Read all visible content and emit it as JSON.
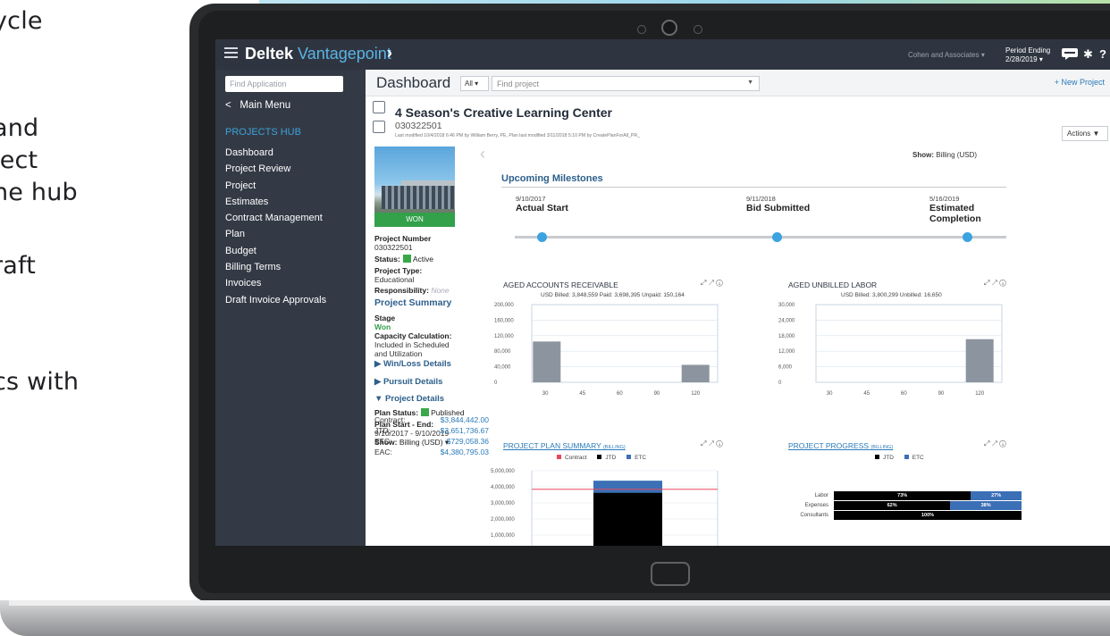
{
  "side_text": [
    "ycle",
    "and",
    "ject",
    "he hub",
    "raft",
    "cs with"
  ],
  "topbar": {
    "brand_main": "Deltek",
    "brand_sub": "Vantagepoint",
    "company": "Cohen and Associates ▾",
    "period_label": "Period Ending",
    "period_value": "2/28/2019 ▾"
  },
  "sidebar": {
    "search_placeholder": "Find Application",
    "main_menu": "Main Menu",
    "hub_title": "PROJECTS HUB",
    "items": [
      "Dashboard",
      "Project Review",
      "Project",
      "Estimates",
      "Contract Management",
      "Plan",
      "Budget",
      "Billing Terms",
      "Invoices",
      "Draft Invoice Approvals"
    ]
  },
  "dashbar": {
    "title": "Dashboard",
    "filter": "All ▾",
    "search_placeholder": "Find project",
    "new_project": "+ New Project"
  },
  "project": {
    "name": "4 Season's Creative Learning Center",
    "number": "030322501",
    "modified": "Last modified 10/4/2018 6:46 PM by William Berry, PE, Plan last modified 3/11/2018 5:10 PM by CreatePlanForAll_PR_",
    "actions": "Actions ▼",
    "status_badge": "WON"
  },
  "info": {
    "project_number_label": "Project Number",
    "project_number_value": "030322501",
    "status_label": "Status:",
    "status_value": "Active",
    "type_label": "Project Type:",
    "type_value": "Educational",
    "resp_label": "Responsibility:",
    "resp_value": "None",
    "summary_title": "Project Summary",
    "stage_label": "Stage",
    "stage_value": "Won",
    "capacity_label": "Capacity Calculation:",
    "capacity_value_1": "Included in Scheduled",
    "capacity_value_2": "and Utilization",
    "winloss": "▶  Win/Loss Details",
    "pursuit": "▶  Pursuit Details",
    "projdetails": "▼  Project Details",
    "plan_status_label": "Plan Status:",
    "plan_status_value": "Published",
    "plan_start_label": "Plan Start - End:",
    "plan_start_value": "9/10/2017 - 9/10/2019",
    "show_label": "Show:",
    "show_value": "Billing (USD) ▾",
    "fin": [
      {
        "label": "Contract:",
        "value": "$3,844,442.00"
      },
      {
        "label": "JTD:",
        "value": "$3,651,736.67"
      },
      {
        "label": "ETC:",
        "value": "$729,058.36"
      },
      {
        "label": "EAC:",
        "value": "$4,380,795.03"
      }
    ]
  },
  "content": {
    "show_label": "Show:",
    "show_value": "Billing (USD)",
    "milestones_title": "Upcoming Milestones",
    "milestones": [
      {
        "date": "9/10/2017",
        "name": "Actual Start",
        "name2": ""
      },
      {
        "date": "9/11/2018",
        "name": "Bid Submitted",
        "name2": ""
      },
      {
        "date": "5/16/2019",
        "name": "Estimated",
        "name2": "Completion"
      }
    ],
    "panel_icons": "⤢  ↗  ⓘ",
    "ar_title": "AGED ACCOUNTS RECEIVABLE",
    "ar_sub": "USD   Billed: 3,848,559  Paid: 3,698,395  Unpaid: 150,164",
    "ul_title": "AGED UNBILLED LABOR",
    "ul_sub": "USD   Billed: 3,800,299   Unbilled: 16,650",
    "plan_title": "PROJECT PLAN SUMMARY",
    "plan_title_small": "(BILLING)",
    "progress_title": "PROJECT PROGRESS",
    "progress_title_small": "(BILLING)",
    "plan_legend": [
      "Contract",
      "JTD",
      "ETC"
    ],
    "progress_legend": [
      "JTD",
      "ETC"
    ]
  },
  "chart_data": [
    {
      "type": "bar",
      "title": "AGED ACCOUNTS RECEIVABLE",
      "categories": [
        "30",
        "45",
        "60",
        "90",
        "120"
      ],
      "values": [
        105000,
        0,
        0,
        0,
        45000
      ],
      "ylim": [
        0,
        200000
      ],
      "yticks": [
        "200,000",
        "160,000",
        "120,000",
        "80,000",
        "40,000",
        "0"
      ],
      "color": "#8c959f"
    },
    {
      "type": "bar",
      "title": "AGED UNBILLED LABOR",
      "categories": [
        "30",
        "45",
        "60",
        "90",
        "120"
      ],
      "values": [
        0,
        0,
        0,
        0,
        16650
      ],
      "ylim": [
        0,
        30000
      ],
      "yticks": [
        "30,000",
        "24,000",
        "18,000",
        "12,000",
        "6,000",
        "0"
      ],
      "color": "#8c959f"
    },
    {
      "type": "bar",
      "title": "PROJECT PLAN SUMMARY (BILLING)",
      "series": [
        {
          "name": "Contract",
          "values": [
            3844442
          ],
          "color": "#e8495a"
        },
        {
          "name": "JTD",
          "values": [
            3651737
          ],
          "color": "#000000"
        },
        {
          "name": "ETC",
          "values": [
            729058
          ],
          "color": "#3b6fb6"
        }
      ],
      "yticks": [
        "5,000,000",
        "4,000,000",
        "3,000,000",
        "2,000,000",
        "1,000,000"
      ],
      "ylim": [
        0,
        5000000
      ]
    },
    {
      "type": "bar",
      "title": "PROJECT PROGRESS (BILLING)",
      "categories": [
        "Labor",
        "Expenses",
        "Consultants"
      ],
      "series": [
        {
          "name": "JTD",
          "values": [
            73,
            62,
            100
          ],
          "color": "#000000"
        },
        {
          "name": "ETC",
          "values": [
            27,
            38,
            0
          ],
          "color": "#3b6fb6"
        }
      ],
      "labels": [
        [
          "73%",
          "27%"
        ],
        [
          "62%",
          "38%"
        ],
        [
          "100%",
          ""
        ]
      ]
    }
  ]
}
